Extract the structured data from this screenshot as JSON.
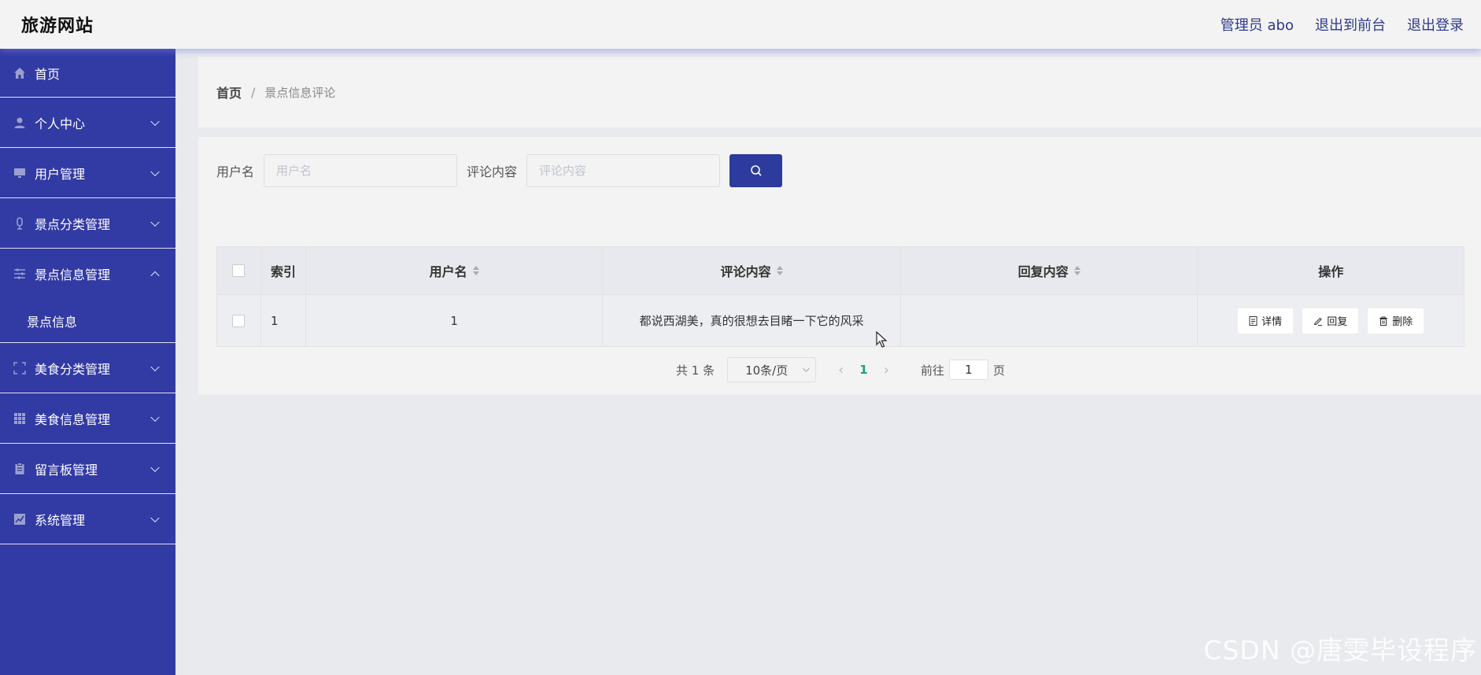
{
  "header": {
    "brand": "旅游网站",
    "admin": "管理员 abo",
    "to_front": "退出到前台",
    "logout": "退出登录"
  },
  "sidebar": {
    "items": [
      {
        "label": "首页",
        "icon": "home-icon"
      },
      {
        "label": "个人中心",
        "icon": "user-icon"
      },
      {
        "label": "用户管理",
        "icon": "monitor-icon"
      },
      {
        "label": "景点分类管理",
        "icon": "mic-icon"
      },
      {
        "label": "景点信息管理",
        "icon": "sliders-icon",
        "expanded": true,
        "children": [
          {
            "label": "景点信息"
          }
        ]
      },
      {
        "label": "美食分类管理",
        "icon": "fullscreen-icon"
      },
      {
        "label": "美食信息管理",
        "icon": "grid-icon"
      },
      {
        "label": "留言板管理",
        "icon": "clipboard-icon"
      },
      {
        "label": "系统管理",
        "icon": "chart-icon"
      }
    ]
  },
  "breadcrumb": {
    "home": "首页",
    "separator": "/",
    "current": "景点信息评论"
  },
  "search": {
    "username_label": "用户名",
    "username_placeholder": "用户名",
    "comment_label": "评论内容",
    "comment_placeholder": "评论内容"
  },
  "table": {
    "headers": {
      "index": "索引",
      "username": "用户名",
      "comment": "评论内容",
      "reply": "回复内容",
      "operation": "操作"
    },
    "rows": [
      {
        "index": "1",
        "username": "1",
        "comment": "都说西湖美，真的很想去目睹一下它的风采",
        "reply": ""
      }
    ],
    "buttons": {
      "detail": "详情",
      "reply": "回复",
      "delete": "删除"
    }
  },
  "pagination": {
    "total": "共 1 条",
    "page_size": "10条/页",
    "current_page": "1",
    "goto_label": "前往",
    "goto_value": "1",
    "page_unit": "页"
  },
  "watermark": "CSDN @唐雯毕设程序",
  "colors": {
    "sidebar": "#323aa4",
    "primary_button": "#2d3a9e",
    "active_page": "#1aa36b"
  }
}
